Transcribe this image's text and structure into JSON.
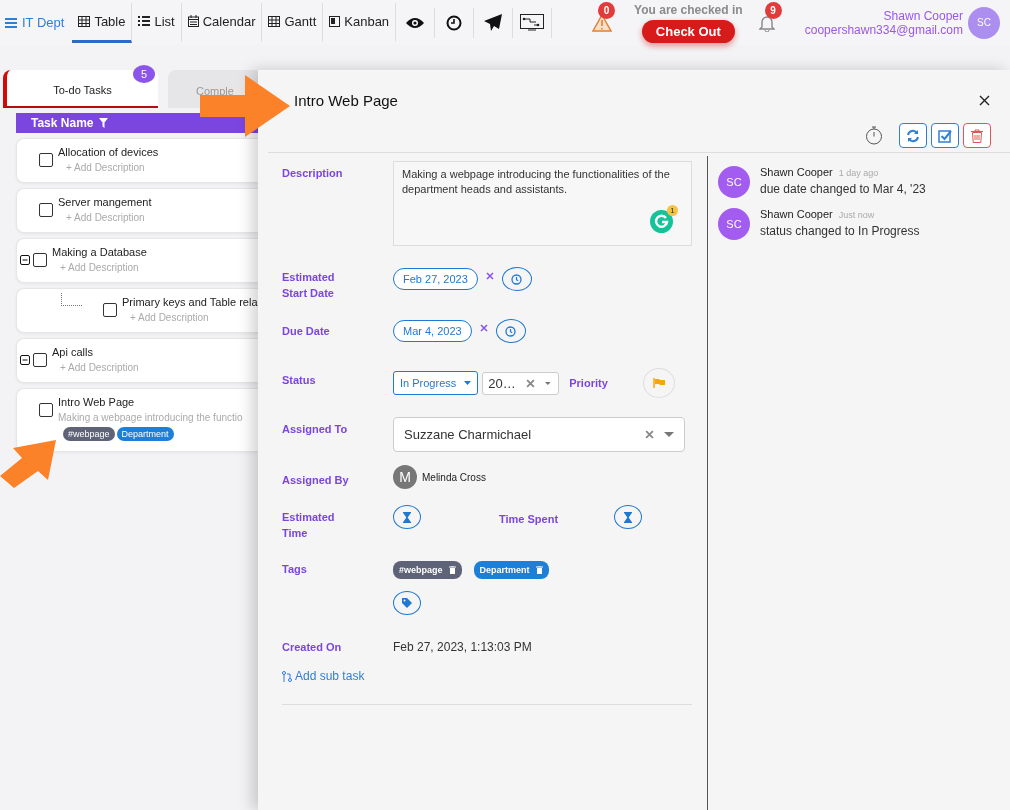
{
  "nav": {
    "brand": "IT Dept",
    "views": [
      {
        "label": "Table",
        "selected": true
      },
      {
        "label": "List",
        "selected": false
      },
      {
        "label": "Calendar",
        "selected": false
      },
      {
        "label": "Gantt",
        "selected": false
      },
      {
        "label": "Kanban",
        "selected": false
      }
    ],
    "alerts_count": "0",
    "checkin_text": "You are checked in",
    "checkout_button": "Check Out",
    "notifications_count": "9",
    "user": {
      "name": "Shawn Cooper",
      "email": "coopershawn334@gmail.com",
      "initials": "SC"
    }
  },
  "task_tabs": [
    {
      "label": "To-do Tasks",
      "count": "5",
      "selected": true
    },
    {
      "label": "Comple",
      "selected": false
    }
  ],
  "table": {
    "column": "Task Name",
    "rows": [
      {
        "title": "Allocation of devices",
        "add_description": "+ Add Description",
        "checked": false
      },
      {
        "title": "Server mangement",
        "add_description": "+ Add Description",
        "checked": false
      },
      {
        "title": "Making a Database",
        "add_description": "+ Add Description",
        "checked": false,
        "expanded": true,
        "children": [
          {
            "title": "Primary keys and Table rela",
            "add_description": "+ Add Description",
            "checked": false
          }
        ]
      },
      {
        "title": "Api calls",
        "add_description": "+ Add Description",
        "checked": false,
        "expanded": true
      },
      {
        "title": "Intro Web Page",
        "description": "Making a webpage introducing the functio",
        "checked": false,
        "tags": [
          {
            "name": "#webpage",
            "color": "#5e6377"
          },
          {
            "name": "Department",
            "color": "#1e7fd8"
          }
        ]
      }
    ]
  },
  "detail": {
    "title": "Intro Web Page",
    "description": {
      "label": "Description",
      "value": "Making a webpage introducing the functionalities of the department heads and assistants.",
      "grammar_count": "1"
    },
    "start_date": {
      "label": "Estimated Start Date",
      "value": "Feb 27, 2023"
    },
    "due_date": {
      "label": "Due Date",
      "value": "Mar 4, 2023"
    },
    "status": {
      "label": "Status",
      "value": "In Progress",
      "second_value": "20…",
      "priority_label": "Priority"
    },
    "assigned_to": {
      "label": "Assigned To",
      "value": "Suzzane Charmichael"
    },
    "assigned_by": {
      "label": "Assigned By",
      "initial": "M",
      "name": "Melinda Cross"
    },
    "estimated_time": {
      "label": "Estimated Time"
    },
    "time_spent": {
      "label": "Time Spent"
    },
    "tags": {
      "label": "Tags",
      "items": [
        {
          "name": "#webpage",
          "color": "#5e6377"
        },
        {
          "name": "Department",
          "color": "#1e7fd8"
        }
      ]
    },
    "created_on": {
      "label": "Created On",
      "value": "Feb 27, 2023, 1:13:03 PM"
    },
    "add_subtask": "Add sub task"
  },
  "activity": [
    {
      "initials": "SC",
      "name": "Shawn Cooper",
      "time": "1 day ago",
      "text": "due date changed to Mar 4, '23"
    },
    {
      "initials": "SC",
      "name": "Shawn Cooper",
      "time": "Just now",
      "text": "status changed to In Progress"
    }
  ]
}
